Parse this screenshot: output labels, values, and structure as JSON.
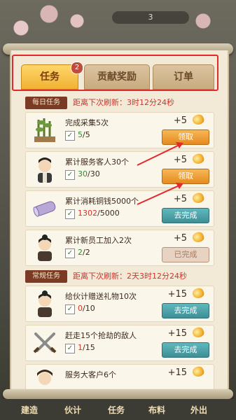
{
  "header": {
    "counter_text": "3"
  },
  "tabs": [
    {
      "label": "任务",
      "badge": "2"
    },
    {
      "label": "贡献奖励"
    },
    {
      "label": "订单"
    }
  ],
  "daily": {
    "tag": "每日任务",
    "refresh": "距离下次刷新：3时12分24秒",
    "tasks": [
      {
        "title": "完成采集5次",
        "cur": "5",
        "total": "/5",
        "reward": "+5",
        "button": "领取"
      },
      {
        "title": "累计服务客人30个",
        "cur": "30",
        "total": "/30",
        "reward": "+5",
        "button": "领取"
      },
      {
        "title": "累计消耗铜钱5000个",
        "cur": "1302",
        "total": "/5000",
        "reward": "+5",
        "button": "去完成"
      },
      {
        "title": "累计新员工加入2次",
        "cur": "2",
        "total": "/2",
        "reward": "+5",
        "button": "已完成"
      }
    ]
  },
  "regular": {
    "tag": "常规任务",
    "refresh": "距离下次刷新：2天3时12分24秒",
    "tasks": [
      {
        "title": "给伙计赠送礼物10次",
        "cur": "0",
        "total": "/10",
        "reward": "+15",
        "button": "去完成"
      },
      {
        "title": "赶走15个抢劫的敌人",
        "cur": "1",
        "total": "/15",
        "reward": "+15",
        "button": "去完成"
      },
      {
        "title": "服务大客户6个",
        "reward": "+15"
      }
    ]
  },
  "nav": [
    "建造",
    "伙计",
    "任务",
    "布料",
    "外出"
  ],
  "colors": {
    "highlight": "#e4282b",
    "arrow": "#e4282b"
  }
}
